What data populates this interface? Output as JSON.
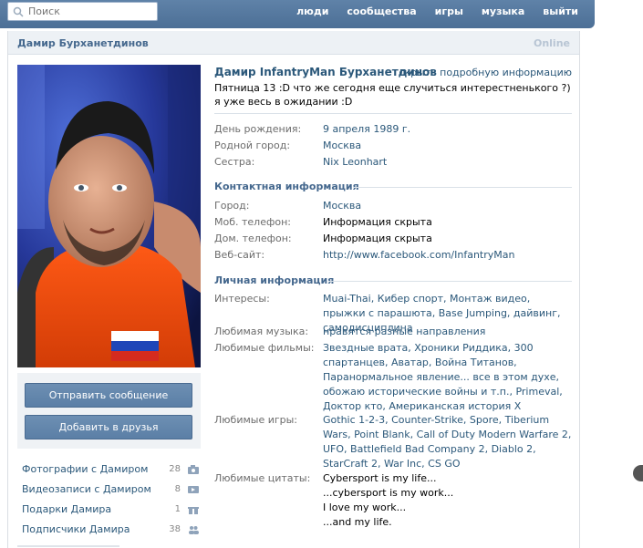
{
  "topbar": {
    "search_placeholder": "Поиск",
    "nav": [
      "люди",
      "сообщества",
      "игры",
      "музыка",
      "выйти"
    ]
  },
  "header": {
    "name": "Дамир Бурханетдинов",
    "status": "Online"
  },
  "profile": {
    "full_name": "Дамир InfantryMan Бурханетдинов",
    "hide_info_link": "скрыть подробную информацию",
    "status": "Пятница 13 :D что же сегодня еще случиться интерестненького ?) я уже весь в ожидании :D"
  },
  "basic_info": [
    {
      "key": "День рождения:",
      "value": "9 апреля 1989 г."
    },
    {
      "key": "Родной город:",
      "value": "Москва"
    },
    {
      "key": "Сестра:",
      "value": "Nix Leonhart"
    }
  ],
  "contacts": {
    "title": "Контактная информация",
    "rows": [
      {
        "key": "Город:",
        "value": "Москва"
      },
      {
        "key": "Моб. телефон:",
        "value": "Информация скрыта"
      },
      {
        "key": "Дом. телефон:",
        "value": "Информация скрыта"
      },
      {
        "key": "Веб-сайт:",
        "value": "http://www.facebook.com/InfantryMan"
      }
    ]
  },
  "personal": {
    "title": "Личная информация",
    "rows": [
      {
        "key": "Интересы:",
        "value": "Muai-Thai, Кибер спорт, Монтаж видео, прыжки с парашюта, Base Jumping, дайвинг, самодисциплина"
      },
      {
        "key": "Любимая музыка:",
        "value": "нравятся разные направления"
      },
      {
        "key": "Любимые фильмы:",
        "value": "Звездные врата, Хроники Риддика, 300 спартанцев, Аватар, Война Титанов, Паранормальное явление... все в этом духе, обожаю исторические войны и т.п., Primeval, Доктор кто, Американская история X"
      },
      {
        "key": "Любимые игры:",
        "value": "Gothic 1-2-3, Counter-Strike, Spore, Tiberium Wars, Point Blank, Call of Duty Modern Warfare 2, UFO, Battlefield Bad Company 2, Diablo 2, StarCraft 2, War Inc, CS GO"
      },
      {
        "key": "Любимые цитаты:",
        "value_lines": [
          "Cybersport is my life...",
          "...cybersport is my work...",
          "I love my work...",
          "...and my life."
        ]
      }
    ]
  },
  "actions": {
    "send_message": "Отправить сообщение",
    "add_friend": "Добавить в друзья"
  },
  "counts": [
    {
      "label": "Фотографии с Дамиром",
      "count": "28",
      "icon": "camera-icon"
    },
    {
      "label": "Видеозаписи с Дамиром",
      "count": "8",
      "icon": "video-icon"
    },
    {
      "label": "Подарки Дамира",
      "count": "1",
      "icon": "gift-icon"
    },
    {
      "label": "Подписчики Дамира",
      "count": "38",
      "icon": "people-icon"
    }
  ],
  "colors": {
    "topbar": "#597da3",
    "link": "#2b587a",
    "section_title": "#45688e",
    "button": "#6083aa"
  }
}
